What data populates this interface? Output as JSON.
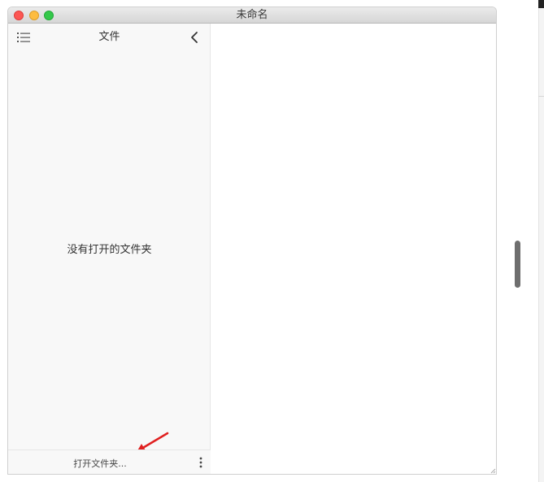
{
  "window": {
    "title": "未命名",
    "traffic_lights": {
      "close_color": "#fc5753",
      "minimize_color": "#fdbc40",
      "maximize_color": "#34c84a"
    }
  },
  "sidebar": {
    "menu_icon": "list-icon",
    "title": "文件",
    "collapse_icon": "chevron-left-icon",
    "empty_message": "没有打开的文件夹",
    "footer": {
      "open_folder_label": "打开文件夹...",
      "more_icon": "vertical-ellipsis-icon"
    }
  },
  "annotation": {
    "arrow_color": "#e02020"
  }
}
